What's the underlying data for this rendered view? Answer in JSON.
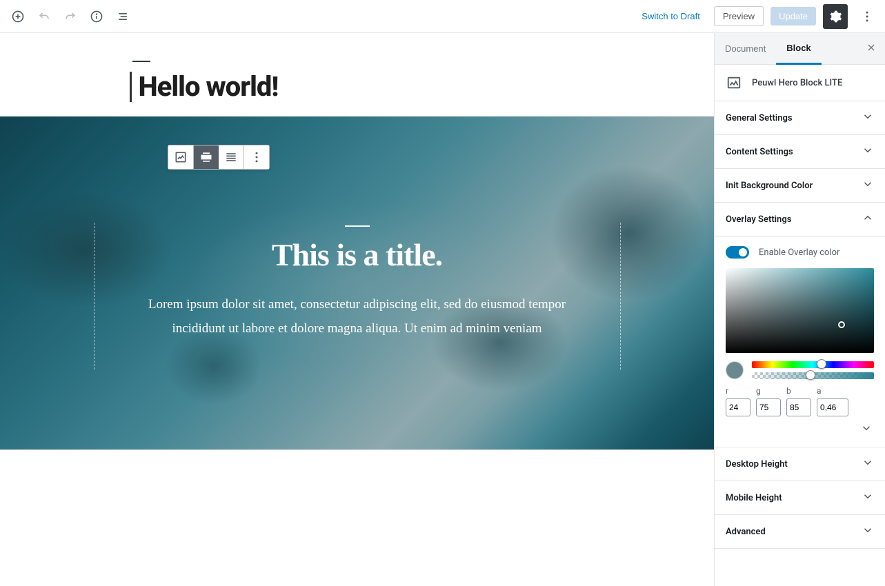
{
  "topbar": {
    "switch_draft": "Switch to Draft",
    "preview": "Preview",
    "update": "Update"
  },
  "document": {
    "title": "Hello world!"
  },
  "hero": {
    "title": "This is a title.",
    "body": "Lorem ipsum dolor sit amet, consectetur adipiscing elit, sed do eiusmod tempor incididunt ut labore et dolore magna aliqua. Ut enim ad minim veniam"
  },
  "sidebar": {
    "tabs": {
      "document": "Document",
      "block": "Block"
    },
    "block_card": "Peuwl Hero Block LITE",
    "panels": {
      "general": "General Settings",
      "content": "Content Settings",
      "initbg": "Init Background Color",
      "overlay": "Overlay Settings",
      "desktop_height": "Desktop Height",
      "mobile_height": "Mobile Height",
      "advanced": "Advanced"
    },
    "overlay": {
      "enable_label": "Enable Overlay color",
      "enabled": true,
      "labels": {
        "r": "r",
        "g": "g",
        "b": "b",
        "a": "a"
      },
      "r": "24",
      "g": "75",
      "b": "85",
      "a": "0,46"
    }
  }
}
